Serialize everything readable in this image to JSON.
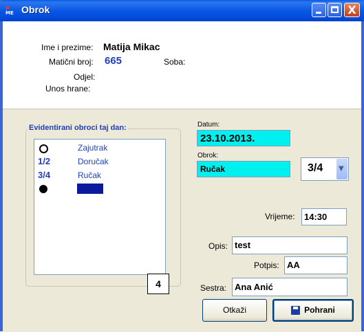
{
  "window": {
    "title": "Obrok",
    "app_icon_text": "ME",
    "app_icon_top": "P",
    "minimize": "minimize",
    "maximize": "maximize",
    "close": "X"
  },
  "patient": {
    "name_label": "Ime i prezime:",
    "name_value": "Matija Mikac",
    "id_label": "Matični broj:",
    "id_value": "665",
    "room_label": "Soba:",
    "room_value": "",
    "dept_label": "Odjel:",
    "dept_value": "",
    "food_label": "Unos hrane:",
    "food_value": ""
  },
  "meals_group": {
    "title": "Evidentirani obroci taj dan:",
    "items": [
      {
        "key": "",
        "marker": "circle-open",
        "name": "Zajutrak"
      },
      {
        "key": "1/2",
        "marker": "",
        "name": "Doručak"
      },
      {
        "key": "3/4",
        "marker": "",
        "name": "Ručak"
      },
      {
        "key": "",
        "marker": "circle-filled",
        "name": "",
        "selected": true
      }
    ],
    "count": "4"
  },
  "form": {
    "date_label": "Datum:",
    "date_value": "23.10.2013.",
    "meal_label": "Obrok:",
    "meal_value": "Ručak",
    "portion_value": "3/4",
    "time_label": "Vrijeme:",
    "time_value": "14:30",
    "desc_label": "Opis:",
    "desc_value": "test",
    "sign_label": "Potpis:",
    "sign_value": "AA",
    "nurse_label": "Sestra:",
    "nurse_value": "Ana Anić"
  },
  "buttons": {
    "cancel": "Otkaži",
    "save": "Pohrani"
  },
  "colors": {
    "title_bar": "#0a58e6",
    "highlight_cyan": "#00f0f0",
    "list_text": "#1f3fb8",
    "panel_bg": "#ece9d8"
  }
}
